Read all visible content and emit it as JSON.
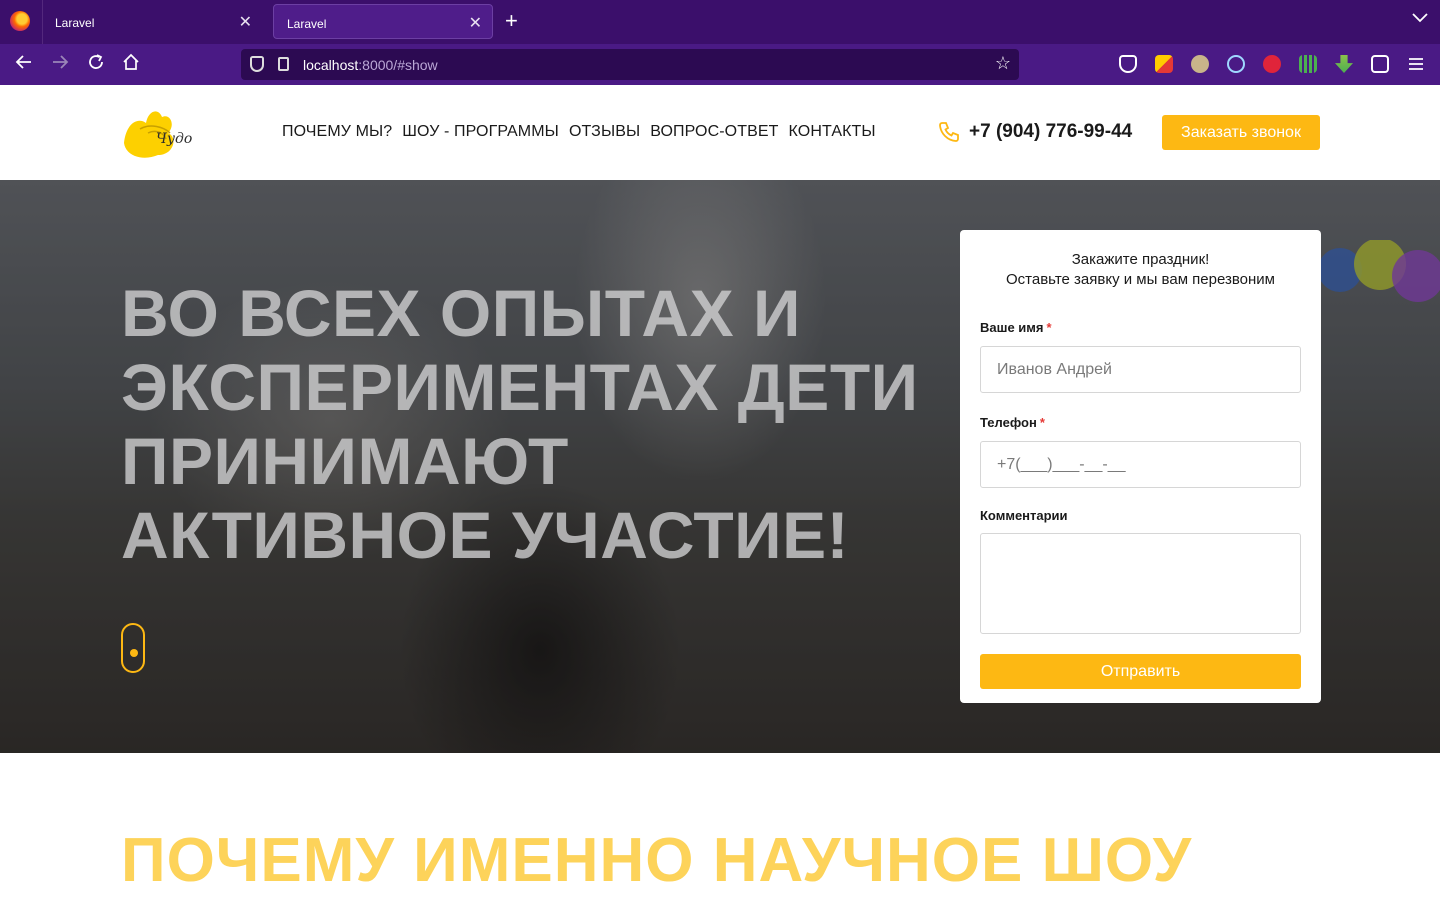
{
  "browser": {
    "tabs": [
      {
        "label": "Laravel",
        "active": false
      },
      {
        "label": "Laravel",
        "active": true
      }
    ],
    "close_glyph": "✕",
    "new_tab_glyph": "+",
    "url": {
      "host": "localhost",
      "rest": ":8000/#show"
    },
    "accent": "#3b0f6b"
  },
  "header": {
    "logo_text": "Чудо",
    "menu": [
      "ПОЧЕМУ МЫ?",
      "ШОУ - ПРОГРАММЫ",
      "ОТЗЫВЫ",
      "ВОПРОС-ОТВЕТ",
      "КОНТАКТЫ"
    ],
    "phone": "+7 (904) 776-99-44",
    "callback_label": "Заказать звонок",
    "brand_color": "#fdb813"
  },
  "hero": {
    "title": "ВО ВСЕХ ОПЫТАХ И ЭКСПЕРИМЕНТАХ ДЕТИ ПРИНИМАЮТ АКТИВНОЕ УЧАСТИЕ!"
  },
  "form": {
    "heading_line1": "Закажите праздник!",
    "heading_line2": "Оставьте заявку и мы вам перезвоним",
    "name_label": "Ваше имя",
    "name_placeholder": "Иванов Андрей",
    "phone_label": "Телефон",
    "phone_placeholder": "+7(___)___-__-__",
    "comment_label": "Комментарии",
    "required_mark": "*",
    "submit_label": "Отправить"
  },
  "section": {
    "title": "ПОЧЕМУ ИМЕННО НАУЧНОЕ ШОУ"
  }
}
